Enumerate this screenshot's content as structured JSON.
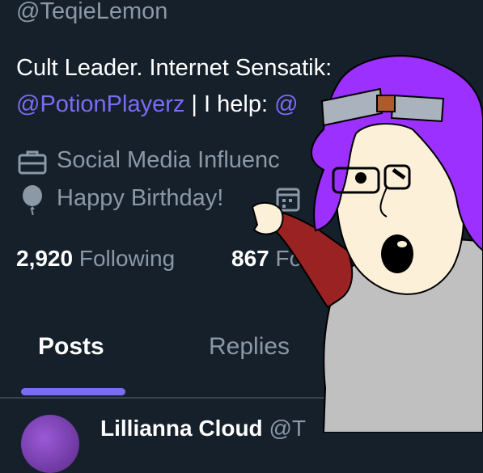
{
  "profile": {
    "handle": "@TeqieLemon",
    "bio_line1": "Cult Leader. Internet Sensati",
    "bio_line1_tail": "k:",
    "bio_mention": "@PotionPlayerz",
    "bio_line2_mid": " | I help: ",
    "bio_line2_tail": "@",
    "category": "Social Media Influenc",
    "birthday": "Happy Birthday!",
    "following_count": "2,920",
    "following_label": "Following",
    "followers_count": "867",
    "followers_label": "Fo"
  },
  "tabs": [
    {
      "label": "Posts",
      "active": true
    },
    {
      "label": "Replies",
      "active": false
    }
  ],
  "post": {
    "author_name": "Lillianna Cloud",
    "author_handle": "@T"
  },
  "colors": {
    "background": "#15202b",
    "accent": "#7b6cf6",
    "muted": "#8b98a5",
    "hair": "#9b30ff"
  },
  "icons": [
    "briefcase-icon",
    "balloon-icon",
    "calendar-icon"
  ]
}
